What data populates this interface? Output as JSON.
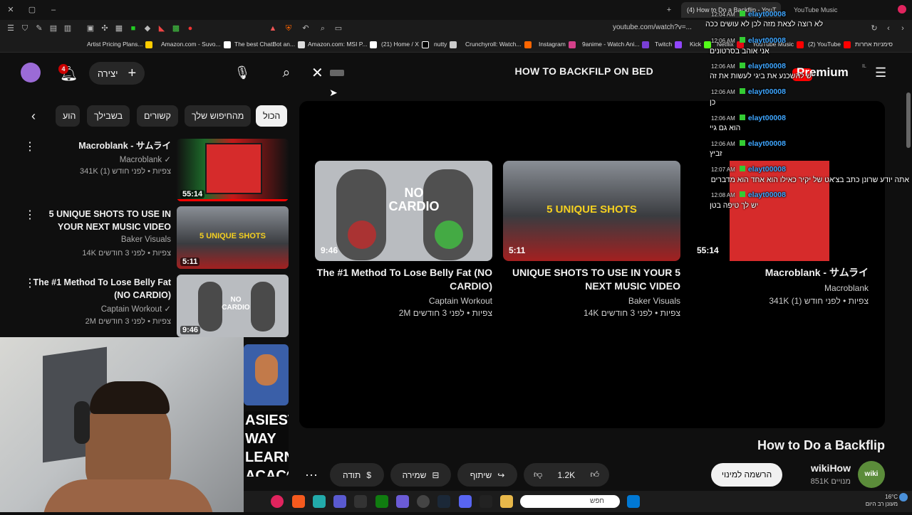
{
  "browser": {
    "tabs": [
      {
        "label": "(4) How to Do a Backflip - YouT..."
      },
      {
        "label": "YouTube Music"
      }
    ],
    "url": "youtube.com/watch?v=...",
    "bookmarks": [
      "Artist Pricing Plans...",
      "Amazon.com - Suvo...",
      "The best ChatBot an...",
      "Amazon.com: MSI P...",
      "(21) Home / X",
      "nutty",
      "Crunchyroll: Watch...",
      "Instagram",
      "9anime - Watch Ani...",
      "Twitch",
      "Kick",
      "Netflix",
      "YouTube Music",
      "(2) YouTube",
      "סימניות אחרות"
    ]
  },
  "header": {
    "notification_count": "4",
    "create_label": "יצירה",
    "search_query": "HOW TO BACKFILP ON BED",
    "premium_label": "Premium",
    "region": "IL"
  },
  "chips": [
    "הכול",
    "מהחיפוש שלך",
    "קשורים",
    "בשבילך",
    "הוע"
  ],
  "sidebar_videos": [
    {
      "title": "Macroblank - サムライ",
      "channel": "Macroblank",
      "meta": "341K צפיות • לפני חודש (1)",
      "duration": "55:14"
    },
    {
      "title": "5 UNIQUE SHOTS TO USE IN YOUR NEXT MUSIC VIDEO",
      "channel": "Baker Visuals",
      "meta": "14K צפיות • לפני 3 חודשים",
      "duration": "5:11",
      "thumb_text": "5 UNIQUE SHOTS"
    },
    {
      "title": "The #1 Method To Lose Belly Fat (NO CARDIO)",
      "channel": "Captain Workout",
      "meta": "2M צפיות • לפני 3 חודשים",
      "duration": "9:46",
      "thumb_text": "NO CARDIO"
    }
  ],
  "partial_thumbs": {
    "text": "ASIEST WAY LEARN ACACO"
  },
  "player_videos": [
    {
      "title": "The #1 Method To Lose Belly Fat (NO CARDIO)",
      "channel": "Captain Workout",
      "meta": "2M צפיות • לפני 3 חודשים",
      "duration": "9:46",
      "thumb_text": "NO CARDIO"
    },
    {
      "title": "UNIQUE SHOTS TO USE IN YOUR 5 NEXT MUSIC VIDEO",
      "channel": "Baker Visuals",
      "meta": "14K צפיות • לפני 3 חודשים",
      "duration": "5:11",
      "thumb_text": "5 UNIQUE SHOTS"
    },
    {
      "title": "Macroblank - サムライ",
      "channel": "Macroblank",
      "meta": "341K צפיות • לפני חודש (1)",
      "duration": "55:14"
    }
  ],
  "video": {
    "title": "How to Do a Backflip",
    "channel": "wikiHow",
    "channel_avatar": "wiki How",
    "subscribers": "851K מנויים",
    "subscribe_label": "הרשמה למינוי",
    "likes": "1.2K",
    "share_label": "שיתוף",
    "save_label": "שמירה",
    "thanks_label": "תודה"
  },
  "chat": [
    {
      "time": "",
      "user": "",
      "text": "לא רוצה לצאת מזה לכן לא עושים ככה"
    },
    {
      "time": "12:04 AM",
      "user": "elayt00008",
      "text": ""
    },
    {
      "time": "12:06 AM",
      "user": "elayt00008",
      "text": "אני אוהב בסרטונים"
    },
    {
      "time": "12:06 AM",
      "user": "elayt00008",
      "text": "יש להשכנע את ביגי לעשות את זה"
    },
    {
      "time": "12:06 AM",
      "user": "elayt00008",
      "text": "כן"
    },
    {
      "time": "12:06 AM",
      "user": "elayt00008",
      "text": "הוא גם גיי"
    },
    {
      "time": "12:06 AM",
      "user": "elayt00008",
      "text": "זביץ"
    },
    {
      "time": "12:07 AM",
      "user": "elayt00008",
      "text": "אתה יודע שרונן כתב בצ'אט של יקיר כאילו הוא אחד הוא מדברים שלו"
    },
    {
      "time": "12:08 AM",
      "user": "elayt00008",
      "text": "יש לך טיפה בטן"
    }
  ],
  "taskbar": {
    "search_placeholder": "חפש",
    "weather_temp": "16°C",
    "weather_desc": "מעונן רב היום"
  },
  "colors": {
    "background": "#0f0f0f",
    "chip_bg": "#272727",
    "accent_red": "#ff0000",
    "link_blue": "#3ea6ff"
  }
}
